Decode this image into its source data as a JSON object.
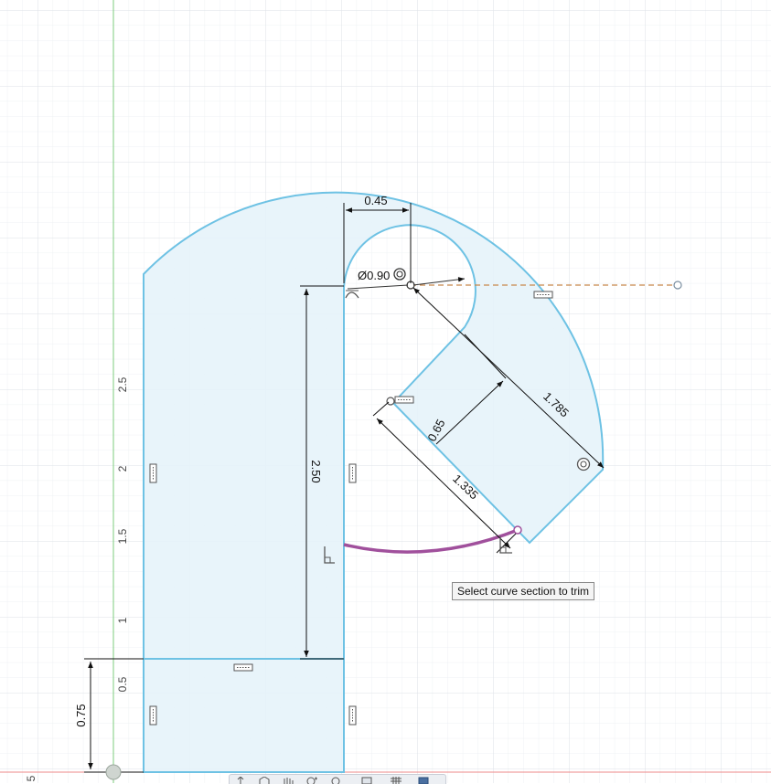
{
  "tooltip": {
    "text": "Select curve section to trim"
  },
  "dimensions": {
    "width_top": "0.45",
    "diameter": "Ø0.90",
    "vertical": "2.50",
    "diagonal_width": "0.65",
    "diagonal_length": "1.335",
    "radius_outer": "1.785",
    "base_height": "0.75"
  },
  "ruler": {
    "labels": [
      "2.5",
      "2",
      "1.5",
      "1",
      "0.5"
    ],
    "corner_label": "5"
  },
  "colors": {
    "sketch_fill": "#e6f3fa",
    "sketch_line": "#6ec2e4",
    "trim_highlight": "#a0509c",
    "construction_line": "#c8884a",
    "grid_minor": "#eef1f4",
    "grid_major": "#dde2e7",
    "axis_green": "#7ccc7c",
    "axis_red": "#e88"
  },
  "toolbar_icons": [
    "orbit-icon",
    "pan-icon",
    "look-icon",
    "zoom-icon",
    "fit-icon",
    "display-settings-icon",
    "grid-settings-icon",
    "viewports-icon"
  ]
}
